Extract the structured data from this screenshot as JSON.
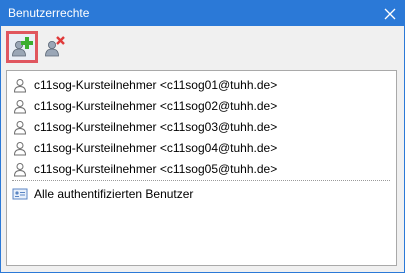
{
  "window": {
    "title": "Benutzerrechte",
    "close_icon": "close-icon"
  },
  "toolbar": {
    "add_user_icon": "add-user-icon",
    "remove_user_icon": "remove-user-icon"
  },
  "users": [
    {
      "label": "c11sog-Kursteilnehmer <c11sog01@tuhh.de>",
      "icon": "user-icon"
    },
    {
      "label": "c11sog-Kursteilnehmer <c11sog02@tuhh.de>",
      "icon": "user-icon"
    },
    {
      "label": "c11sog-Kursteilnehmer <c11sog03@tuhh.de>",
      "icon": "user-icon"
    },
    {
      "label": "c11sog-Kursteilnehmer <c11sog04@tuhh.de>",
      "icon": "user-icon"
    },
    {
      "label": "c11sog-Kursteilnehmer <c11sog05@tuhh.de>",
      "icon": "user-icon"
    }
  ],
  "groups": [
    {
      "label": "Alle authentifizierten Benutzer",
      "icon": "group-card-icon"
    }
  ],
  "colors": {
    "titlebar": "#2b79d7",
    "highlight_border": "#e0565f",
    "add_plus": "#3cae2f",
    "remove_x": "#e03a3a"
  }
}
